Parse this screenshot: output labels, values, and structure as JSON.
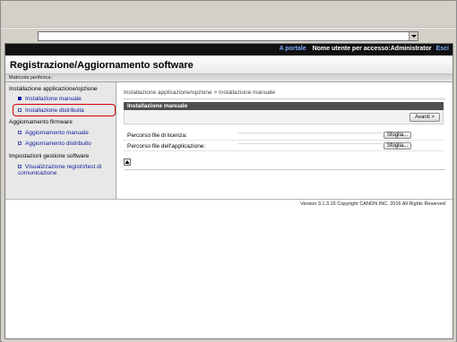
{
  "header": {
    "portal_link": "A portale",
    "user_label": "Nome utente per accesso:Administrator",
    "logout_link": "Esci"
  },
  "page": {
    "title": "Registrazione/Aggiornamento software",
    "serial_label": "Matricola periferica:"
  },
  "sidebar": {
    "categories": [
      {
        "label": "Installazione applicazione/opzione"
      },
      {
        "label": "Aggiornamento firmware"
      },
      {
        "label": "Impostazioni gestione software"
      }
    ],
    "items": [
      {
        "label": "Installazione manuale",
        "selected": true
      },
      {
        "label": "Installazione distribuita",
        "selected": false
      },
      {
        "label": "Aggiornamento manuale",
        "selected": false
      },
      {
        "label": "Aggiornamento distribuito",
        "selected": false
      },
      {
        "label": "Visualizzazione registri/test di comunicazione",
        "selected": false
      }
    ]
  },
  "main": {
    "breadcrumb": "Installazione applicazione/opzione > Installazione manuale",
    "section_title": "Installazione manuale",
    "next_button": "Avanti >",
    "rows": [
      {
        "label": "Percorso file di licenza:",
        "browse": "Sfoglia..."
      },
      {
        "label": "Percorso file dell'applicazione:",
        "browse": "Sfoglia..."
      }
    ]
  },
  "footer": {
    "copyright": "Version 3.1.3.15 Copyright CANON INC. 2016 All Rights Reserved"
  },
  "icons": {
    "dropdown": "chevron-down-icon",
    "back_to_top": "arrow-up-icon"
  },
  "colors": {
    "topbar_bg": "#111111",
    "link_blue": "#0e1b9a",
    "section_header": "#4f4f4f",
    "highlight_red": "#d40000"
  }
}
